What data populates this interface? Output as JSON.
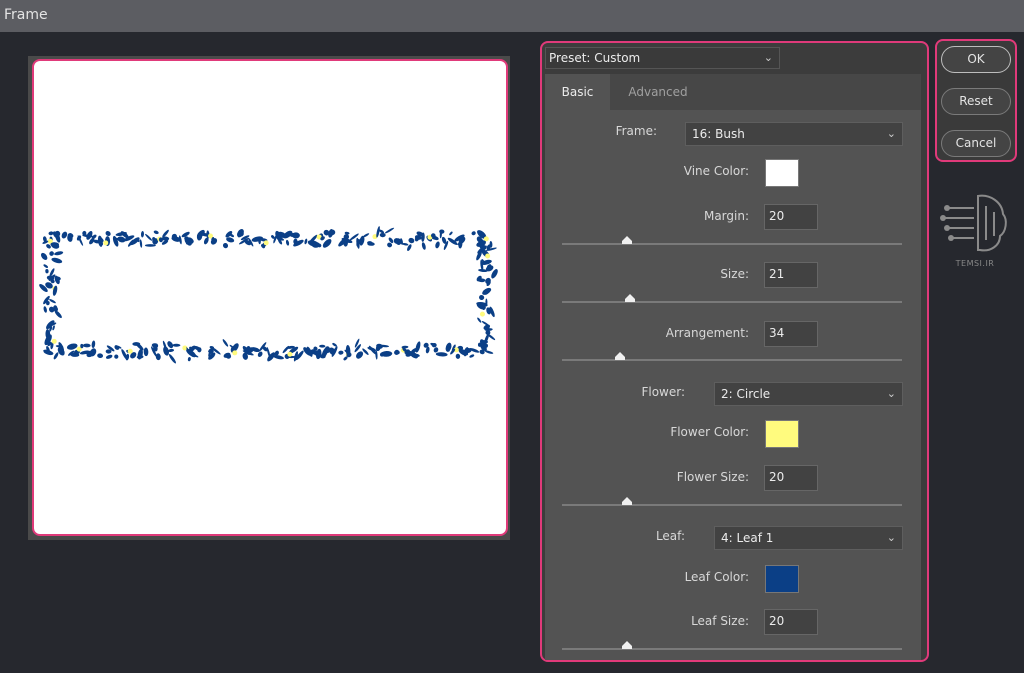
{
  "window": {
    "title": "Frame"
  },
  "preset": {
    "label": "Preset: Custom"
  },
  "tabs": [
    {
      "label": "Basic"
    },
    {
      "label": "Advanced"
    }
  ],
  "controls": {
    "frame": {
      "label": "Frame:",
      "value": "16: Bush"
    },
    "vine_color": {
      "label": "Vine Color:",
      "color": "#ffffff"
    },
    "margin": {
      "label": "Margin:",
      "value": "20",
      "slider_fraction": 0.19
    },
    "size": {
      "label": "Size:",
      "value": "21",
      "slider_fraction": 0.2
    },
    "arrangement": {
      "label": "Arrangement:",
      "value": "34",
      "slider_fraction": 0.17
    },
    "flower": {
      "label": "Flower:",
      "value": "2: Circle"
    },
    "flower_color": {
      "label": "Flower Color:",
      "color": "#fffb7e"
    },
    "flower_size": {
      "label": "Flower Size:",
      "value": "20",
      "slider_fraction": 0.19
    },
    "leaf": {
      "label": "Leaf:",
      "value": "4: Leaf 1"
    },
    "leaf_color": {
      "label": "Leaf Color:",
      "color": "#0b3f86"
    },
    "leaf_size": {
      "label": "Leaf Size:",
      "value": "20",
      "slider_fraction": 0.19
    }
  },
  "buttons": {
    "ok": "OK",
    "reset": "Reset",
    "cancel": "Cancel"
  },
  "watermark": {
    "text": "TEMSI.IR"
  }
}
